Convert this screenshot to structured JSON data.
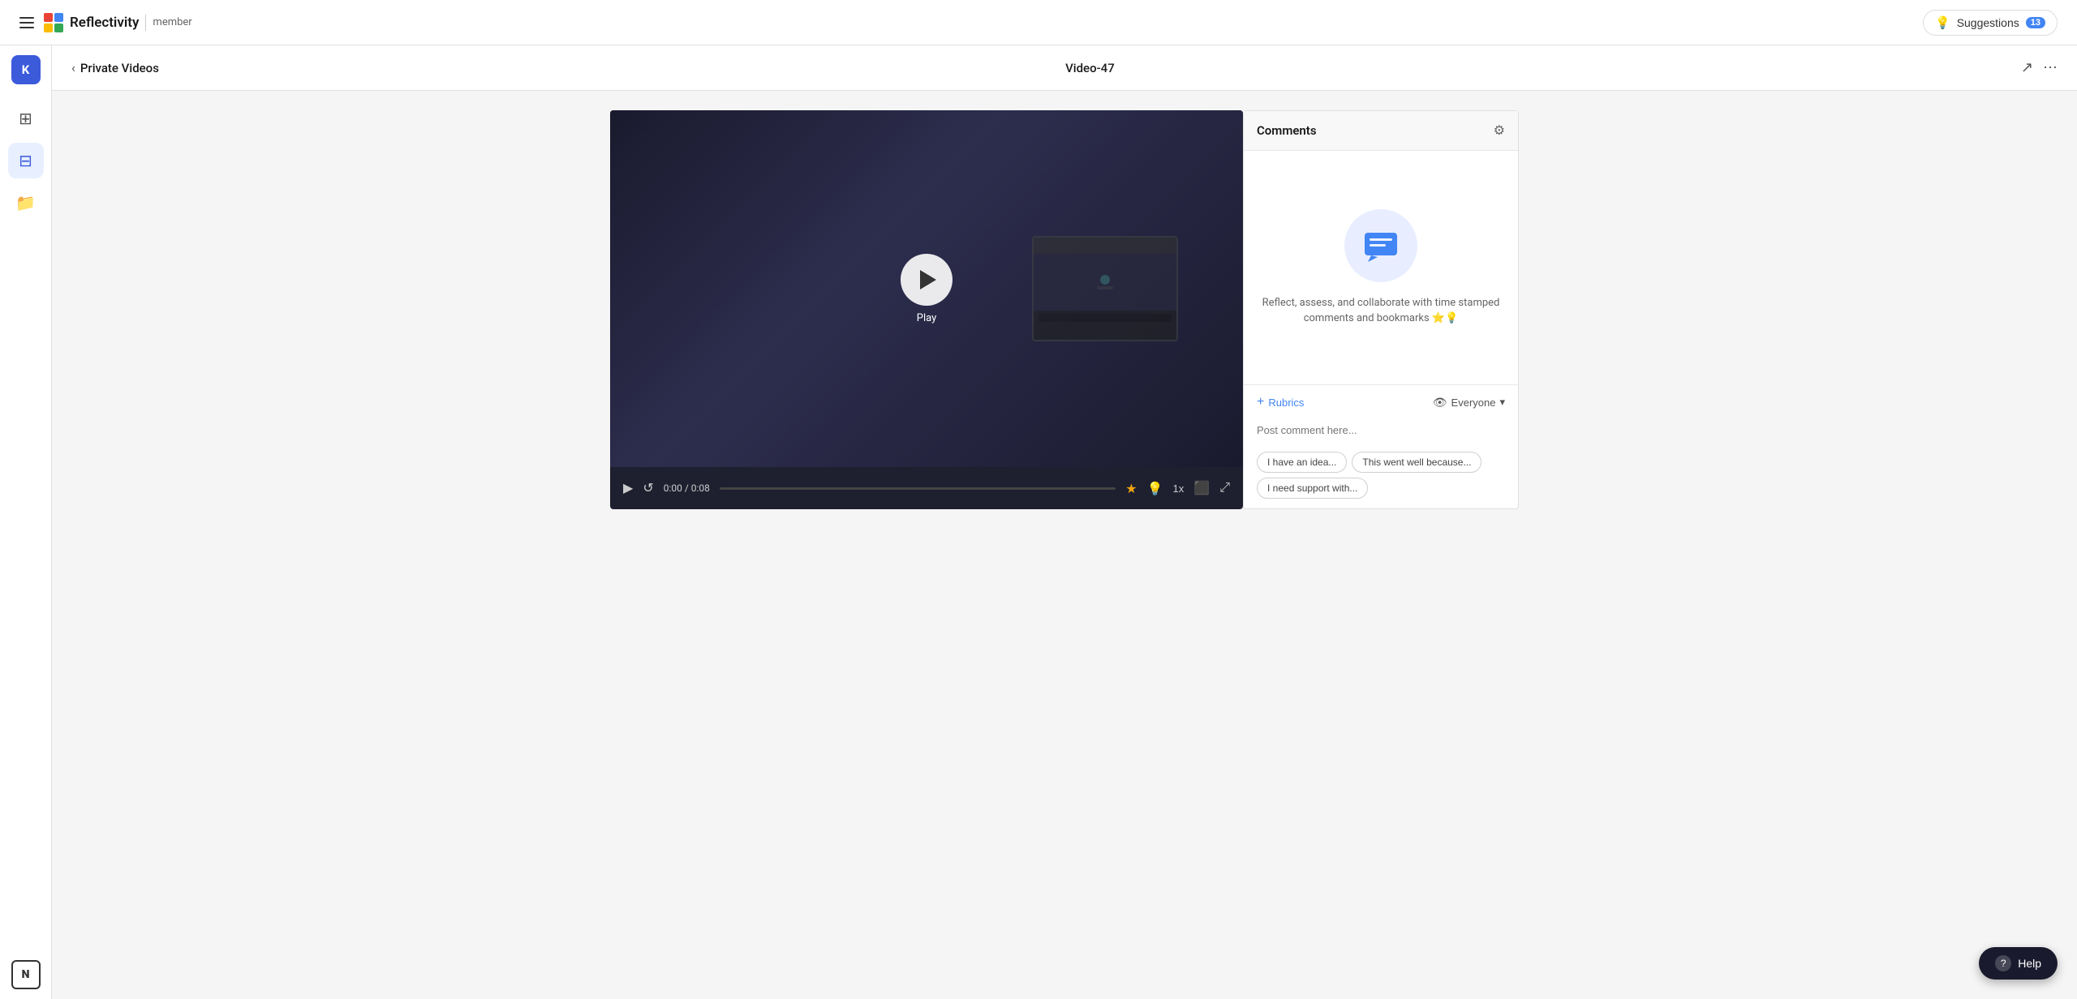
{
  "topnav": {
    "menu_icon": "hamburger",
    "logo_text": "Reflectivity",
    "logo_divider": "|",
    "role": "member",
    "suggestions_label": "Suggestions",
    "suggestions_count": "13",
    "bulb_icon": "💡"
  },
  "sidebar": {
    "avatar_letter": "K",
    "items": [
      {
        "id": "dashboard",
        "icon": "⊞",
        "label": "Dashboard"
      },
      {
        "id": "video-grid",
        "icon": "⊟",
        "label": "Video Grid",
        "active": true
      },
      {
        "id": "folder",
        "icon": "📁",
        "label": "Folder"
      }
    ],
    "notion_label": "N"
  },
  "subheader": {
    "back_icon": "‹",
    "back_label": "Private Videos",
    "video_title": "Video-47",
    "share_icon": "↗",
    "more_icon": "⋯"
  },
  "video": {
    "time_current": "0:00",
    "time_total": "0:08",
    "time_display": "0:00 / 0:08",
    "speed": "1x",
    "play_label": "Play"
  },
  "comments": {
    "title": "Comments",
    "description": "Reflect, assess, and collaborate with time stamped comments and bookmarks ⭐💡",
    "rubrics_label": "Rubrics",
    "audience_label": "Everyone",
    "input_placeholder": "Post comment here...",
    "chips": [
      {
        "label": "I have an idea..."
      },
      {
        "label": "This went well because..."
      },
      {
        "label": "I need support with..."
      }
    ]
  },
  "help": {
    "label": "Help"
  }
}
